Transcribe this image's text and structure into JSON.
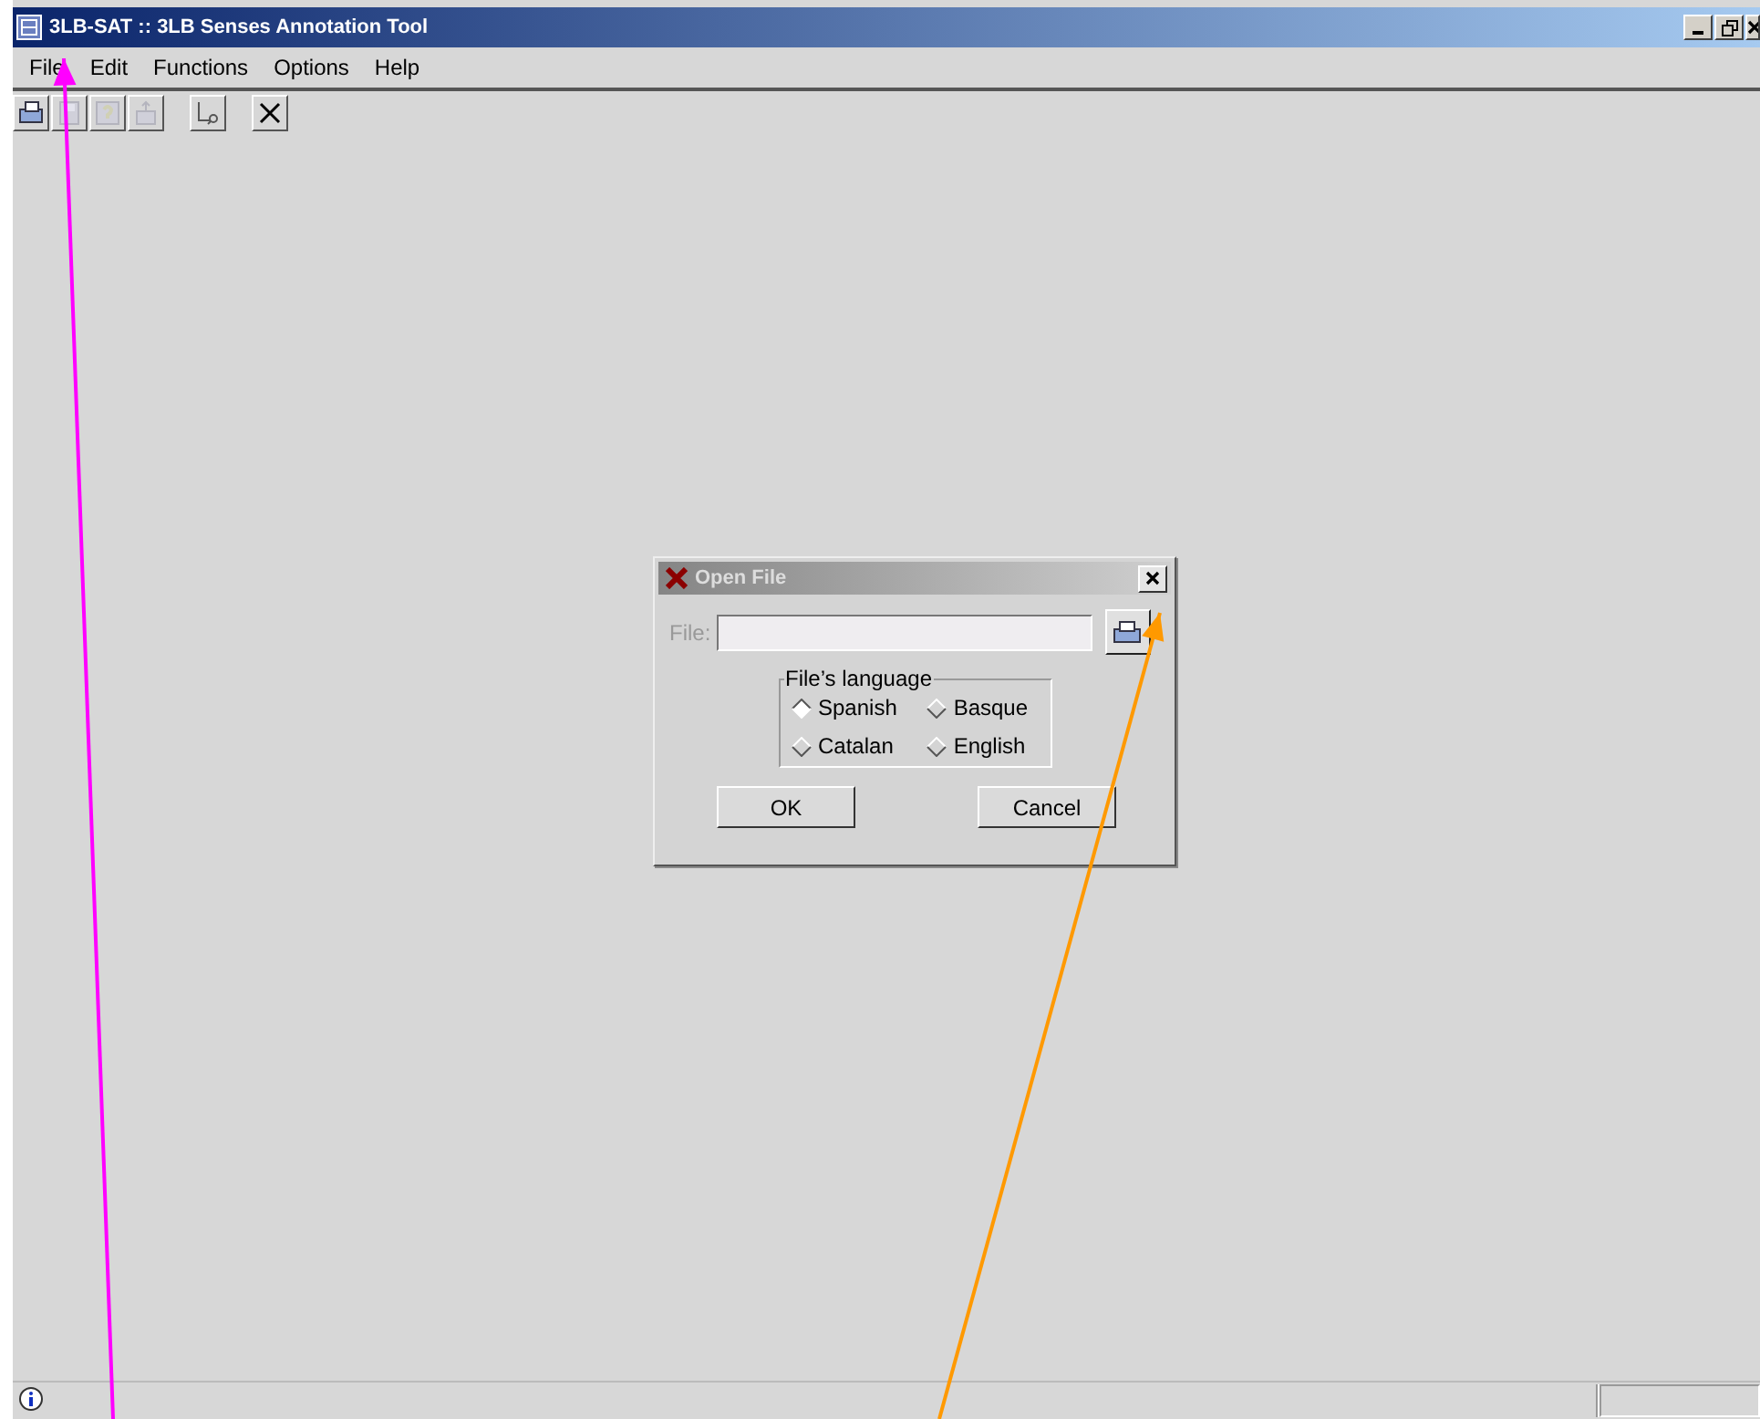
{
  "window": {
    "title": "3LB-SAT :: 3LB Senses Annotation Tool"
  },
  "menu": [
    "File",
    "Edit",
    "Functions",
    "Options",
    "Help"
  ],
  "toolbar": [
    {
      "kind": "open",
      "disabled": false
    },
    {
      "kind": "save",
      "disabled": true
    },
    {
      "kind": "help",
      "disabled": true
    },
    {
      "kind": "export",
      "disabled": true
    },
    {
      "kind": "lookup",
      "disabled": false
    },
    {
      "kind": "close",
      "disabled": false
    }
  ],
  "dialog": {
    "title": "Open File",
    "file_label": "File:",
    "group_title": "File’s language",
    "languages": [
      {
        "label": "Spanish",
        "selected": true
      },
      {
        "label": "Basque",
        "selected": false
      },
      {
        "label": "Catalan",
        "selected": false
      },
      {
        "label": "English",
        "selected": false
      }
    ],
    "buttons": [
      "OK",
      "Cancel"
    ]
  },
  "annotations": [
    {
      "color": "#ff00ff"
    },
    {
      "color": "#ff9900"
    }
  ]
}
